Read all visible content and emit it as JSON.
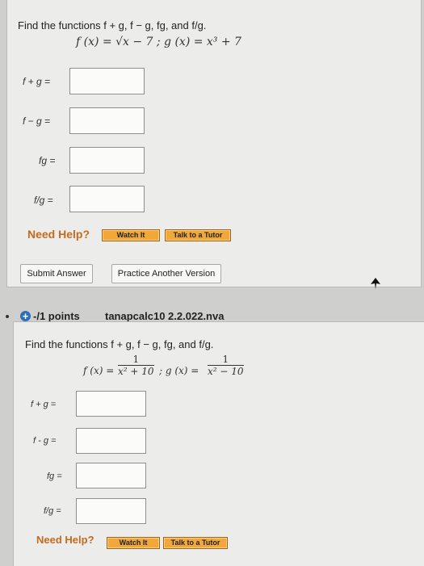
{
  "q1": {
    "prompt": "Find the functions f + g, f − g, fg, and f/g.",
    "formula": "f (x) = √x − 7 ; g (x) = x³ + 7",
    "labels": [
      "f + g  =",
      "f − g  =",
      "fg  =",
      "f/g  ="
    ],
    "need_help": "Need Help?",
    "watch_label": "Watch It",
    "talk_label": "Talk to a Tutor",
    "submit_label": "Submit Answer",
    "practice_label": "Practice Another Version"
  },
  "q2": {
    "points": "-/1 points",
    "code": "tanapcalc10 2.2.022.nva",
    "prompt": "Find the functions f + g, f − g, fg, and f/g.",
    "f_lhs": "f (x) =",
    "f_num": "1",
    "f_den": "x² + 10",
    "g_lhs": "; g (x) =",
    "g_num": "1",
    "g_den": "x² − 10",
    "labels": [
      "f + g  =",
      "f - g  =",
      "fg  =",
      "f/g  ="
    ],
    "need_help": "Need Help?",
    "watch_label": "Watch It",
    "talk_label": "Talk to a Tutor"
  }
}
